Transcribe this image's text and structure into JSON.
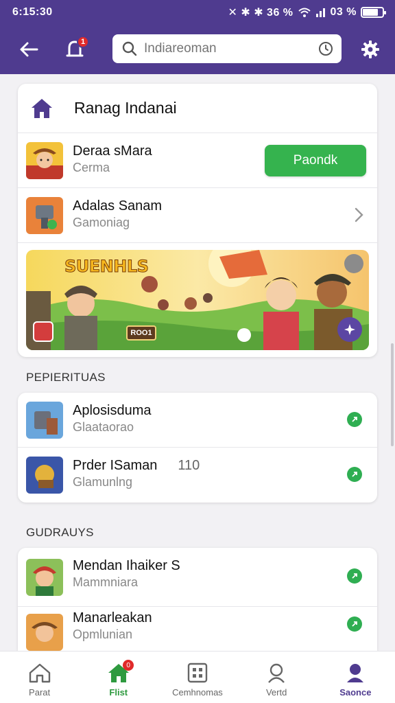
{
  "status_bar": {
    "time": "6:15:30",
    "icons_text": "✕ ✱ ✱ 36 %",
    "battery_text": "03 %",
    "battery_level": 0.8
  },
  "app_bar": {
    "back_icon": "arrow-left-icon",
    "bell_icon": "bell-icon",
    "bell_badge": "1",
    "search_placeholder": "Indiareoman",
    "gear_icon": "gear-icon"
  },
  "featured": {
    "title": "Ranag Indanai",
    "items": [
      {
        "title": "Deraa sMara",
        "subtitle": "Cerma",
        "action": "Paondk"
      },
      {
        "title": "Adalas Sanam",
        "subtitle": "Gamoniag"
      }
    ],
    "banner_logo": "SUENHLS",
    "banner_tag": "ROO1"
  },
  "sections": [
    {
      "label": "PEPIERITUAS",
      "items": [
        {
          "title": "Aplosisduma",
          "subtitle": "Glaataorao",
          "extra": ""
        },
        {
          "title": "Prder ISaman",
          "subtitle": "Glamunlng",
          "extra": "110"
        }
      ]
    },
    {
      "label": "GUDRAUYS",
      "items": [
        {
          "title": "Mendan Ihaiker S",
          "subtitle": "Mammniara"
        },
        {
          "title": "Manarleakan",
          "subtitle": "Opmlunian"
        }
      ]
    }
  ],
  "bottom_nav": [
    {
      "label": "Parat",
      "icon": "home-icon",
      "active": false
    },
    {
      "label": "Flist",
      "icon": "home-icon",
      "active": true,
      "badge": "0"
    },
    {
      "label": "Cemhnomas",
      "icon": "grid-icon",
      "active": false
    },
    {
      "label": "Vertd",
      "icon": "user-search-icon",
      "active": false
    },
    {
      "label": "Saonce",
      "icon": "profile-icon",
      "active": false
    }
  ],
  "colors": {
    "header": "#4f3b8f",
    "accent_green": "#35b34e",
    "active_nav_green": "#2e9a3f",
    "active_nav_purple": "#4f3b8f"
  }
}
